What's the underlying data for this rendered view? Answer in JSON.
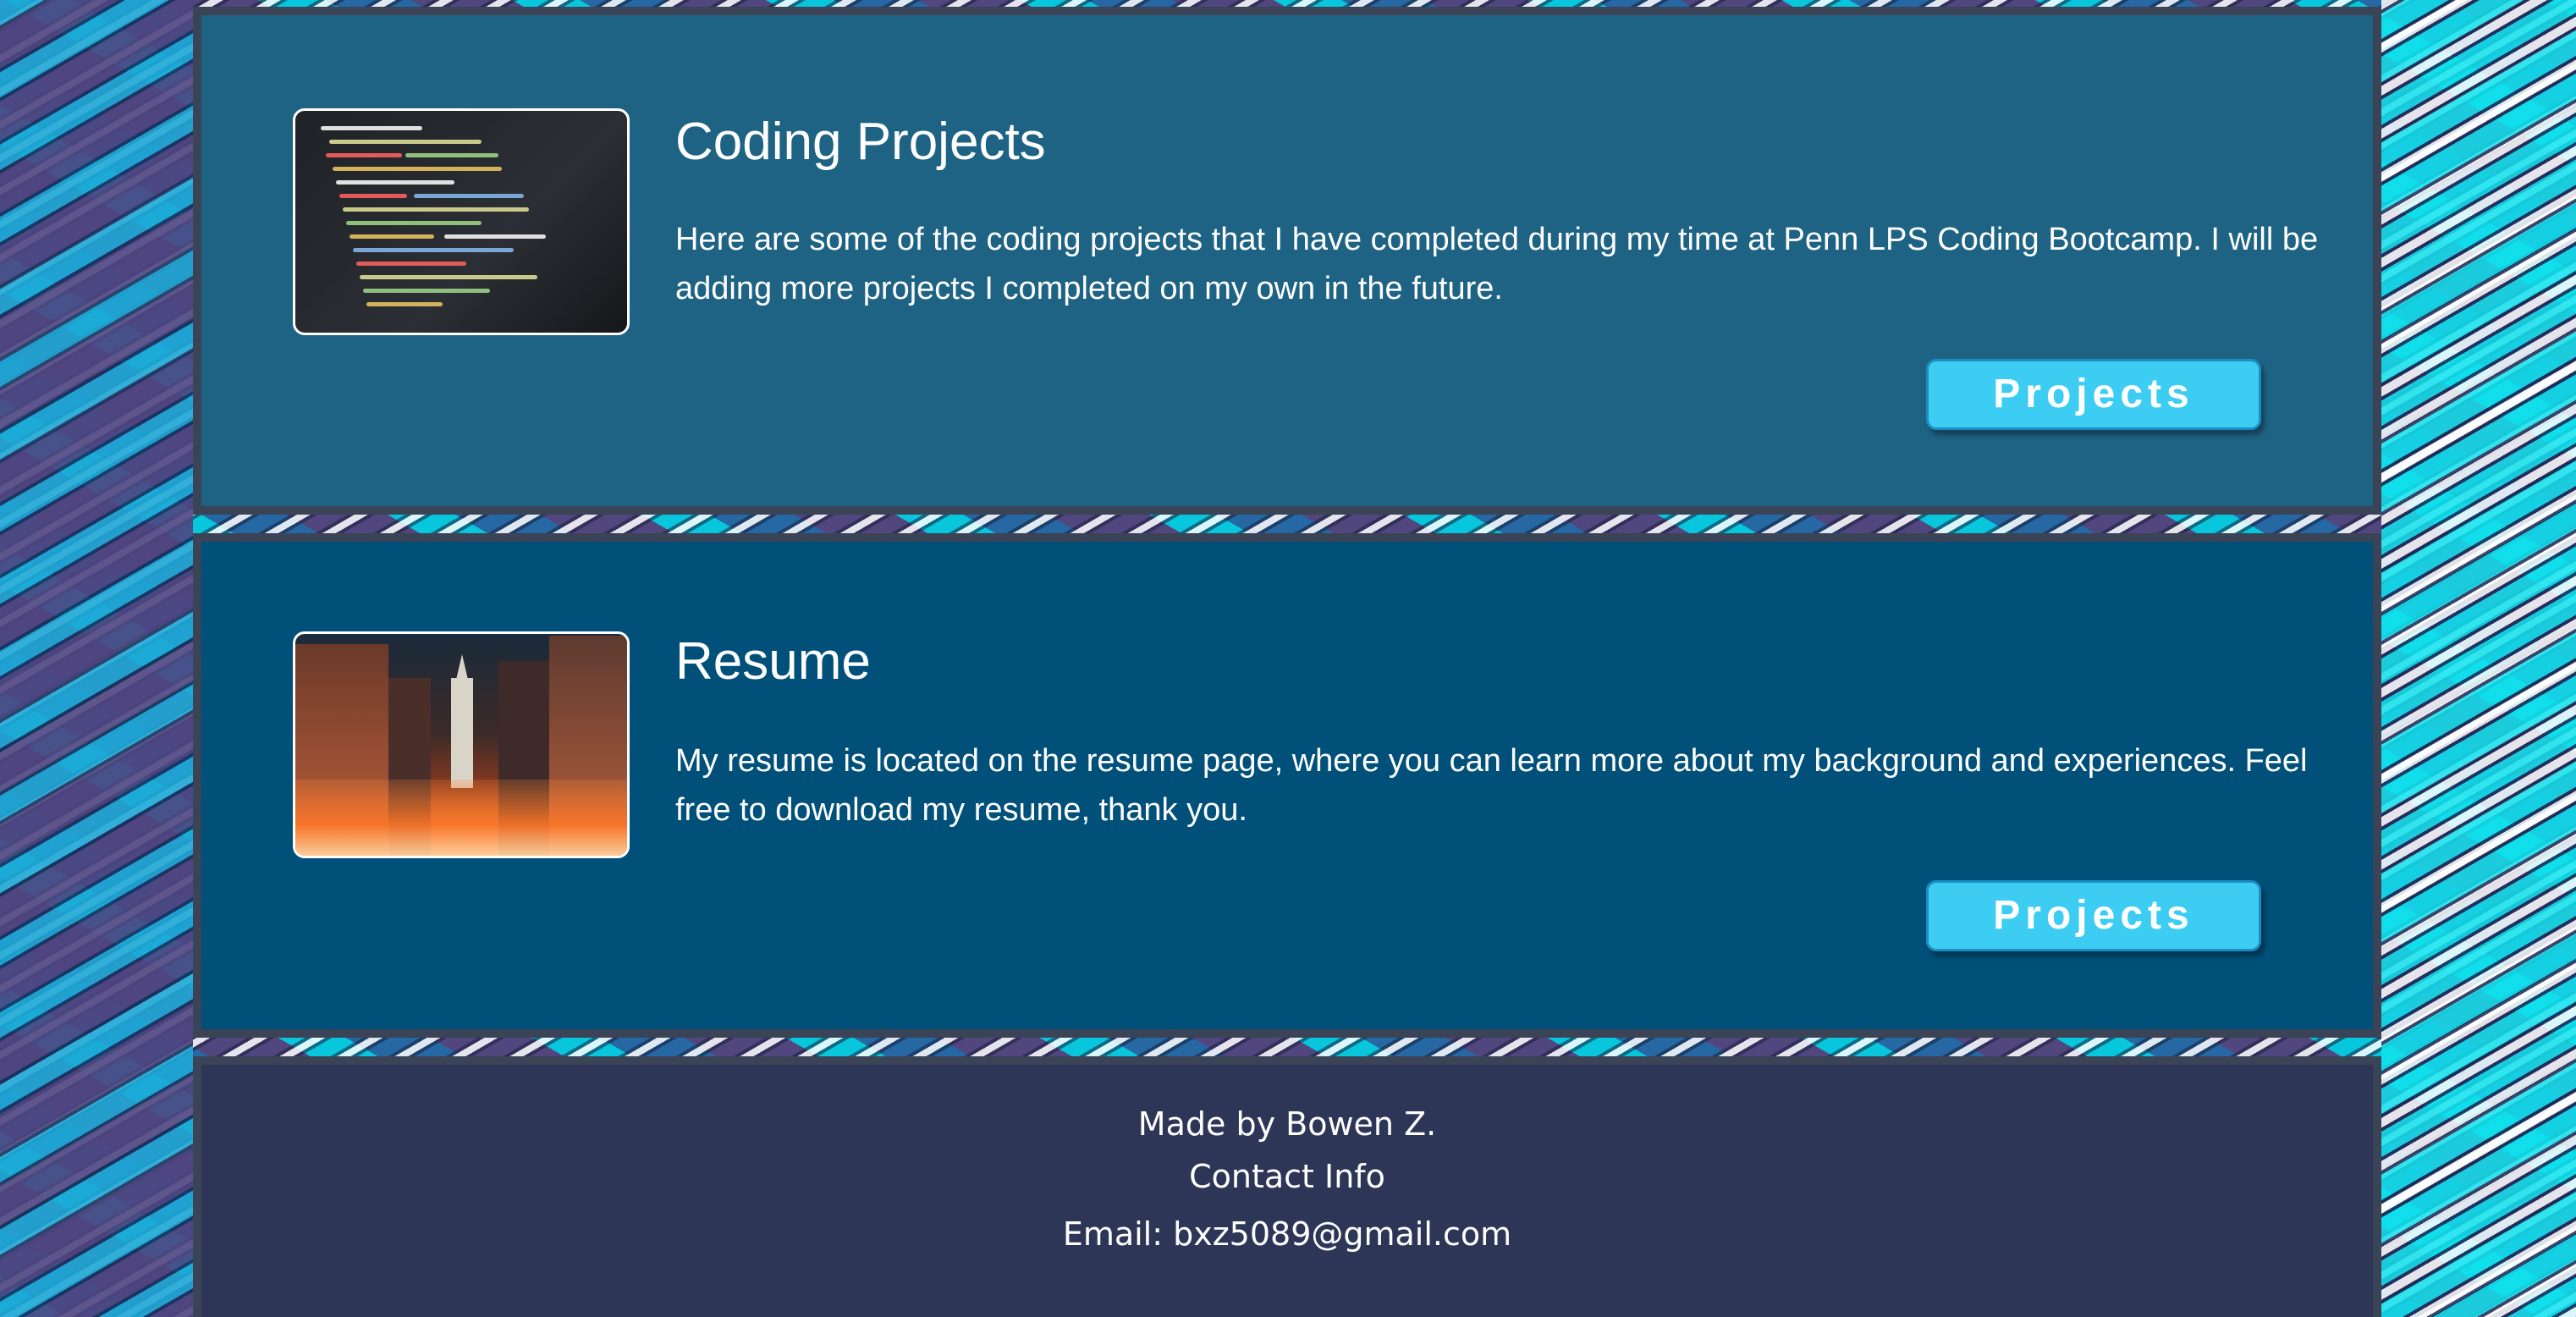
{
  "cards": [
    {
      "title": "Coding Projects",
      "text": "Here are some of the coding projects that I have completed during my time at Penn LPS Coding Bootcamp. I will be adding more projects I completed on my own in the future.",
      "button_label": "Projects",
      "image": "code-screen-photo"
    },
    {
      "title": "Resume",
      "text": "My resume is located on the resume page, where you can learn more about my background and experiences. Feel free to download my resume, thank you.",
      "button_label": "Projects",
      "image": "philadelphia-city-hall-street-photo"
    }
  ],
  "footer": {
    "made_by": "Made by Bowen Z.",
    "contact_heading": "Contact Info",
    "email": "Email: bxz5089@gmail.com"
  },
  "colors": {
    "card_1_bg": "#1e6384",
    "card_2_bg": "#00507a",
    "footer_bg": "#2d3657",
    "button_bg": "#3dcdf2",
    "border": "#3b4356"
  }
}
